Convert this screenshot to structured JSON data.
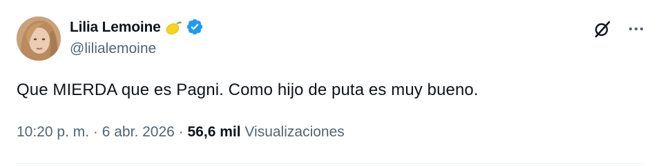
{
  "author": {
    "display_name": "Lilia Lemoine",
    "handle": "@lilialemoine",
    "verified": true,
    "name_emoji": "lemon-icon",
    "accent_color": "#1d9bf0"
  },
  "tweet": {
    "text": "Que MIERDA que es Pagni. Como hijo de puta es muy bueno.",
    "time": "10:20 p. m.",
    "separator": " · ",
    "date": "6 abr. 2026",
    "views_count": "56,6 mil",
    "views_label": "Visualizaciones"
  },
  "icons": {
    "grok": "grok-icon",
    "more": "more-icon"
  }
}
